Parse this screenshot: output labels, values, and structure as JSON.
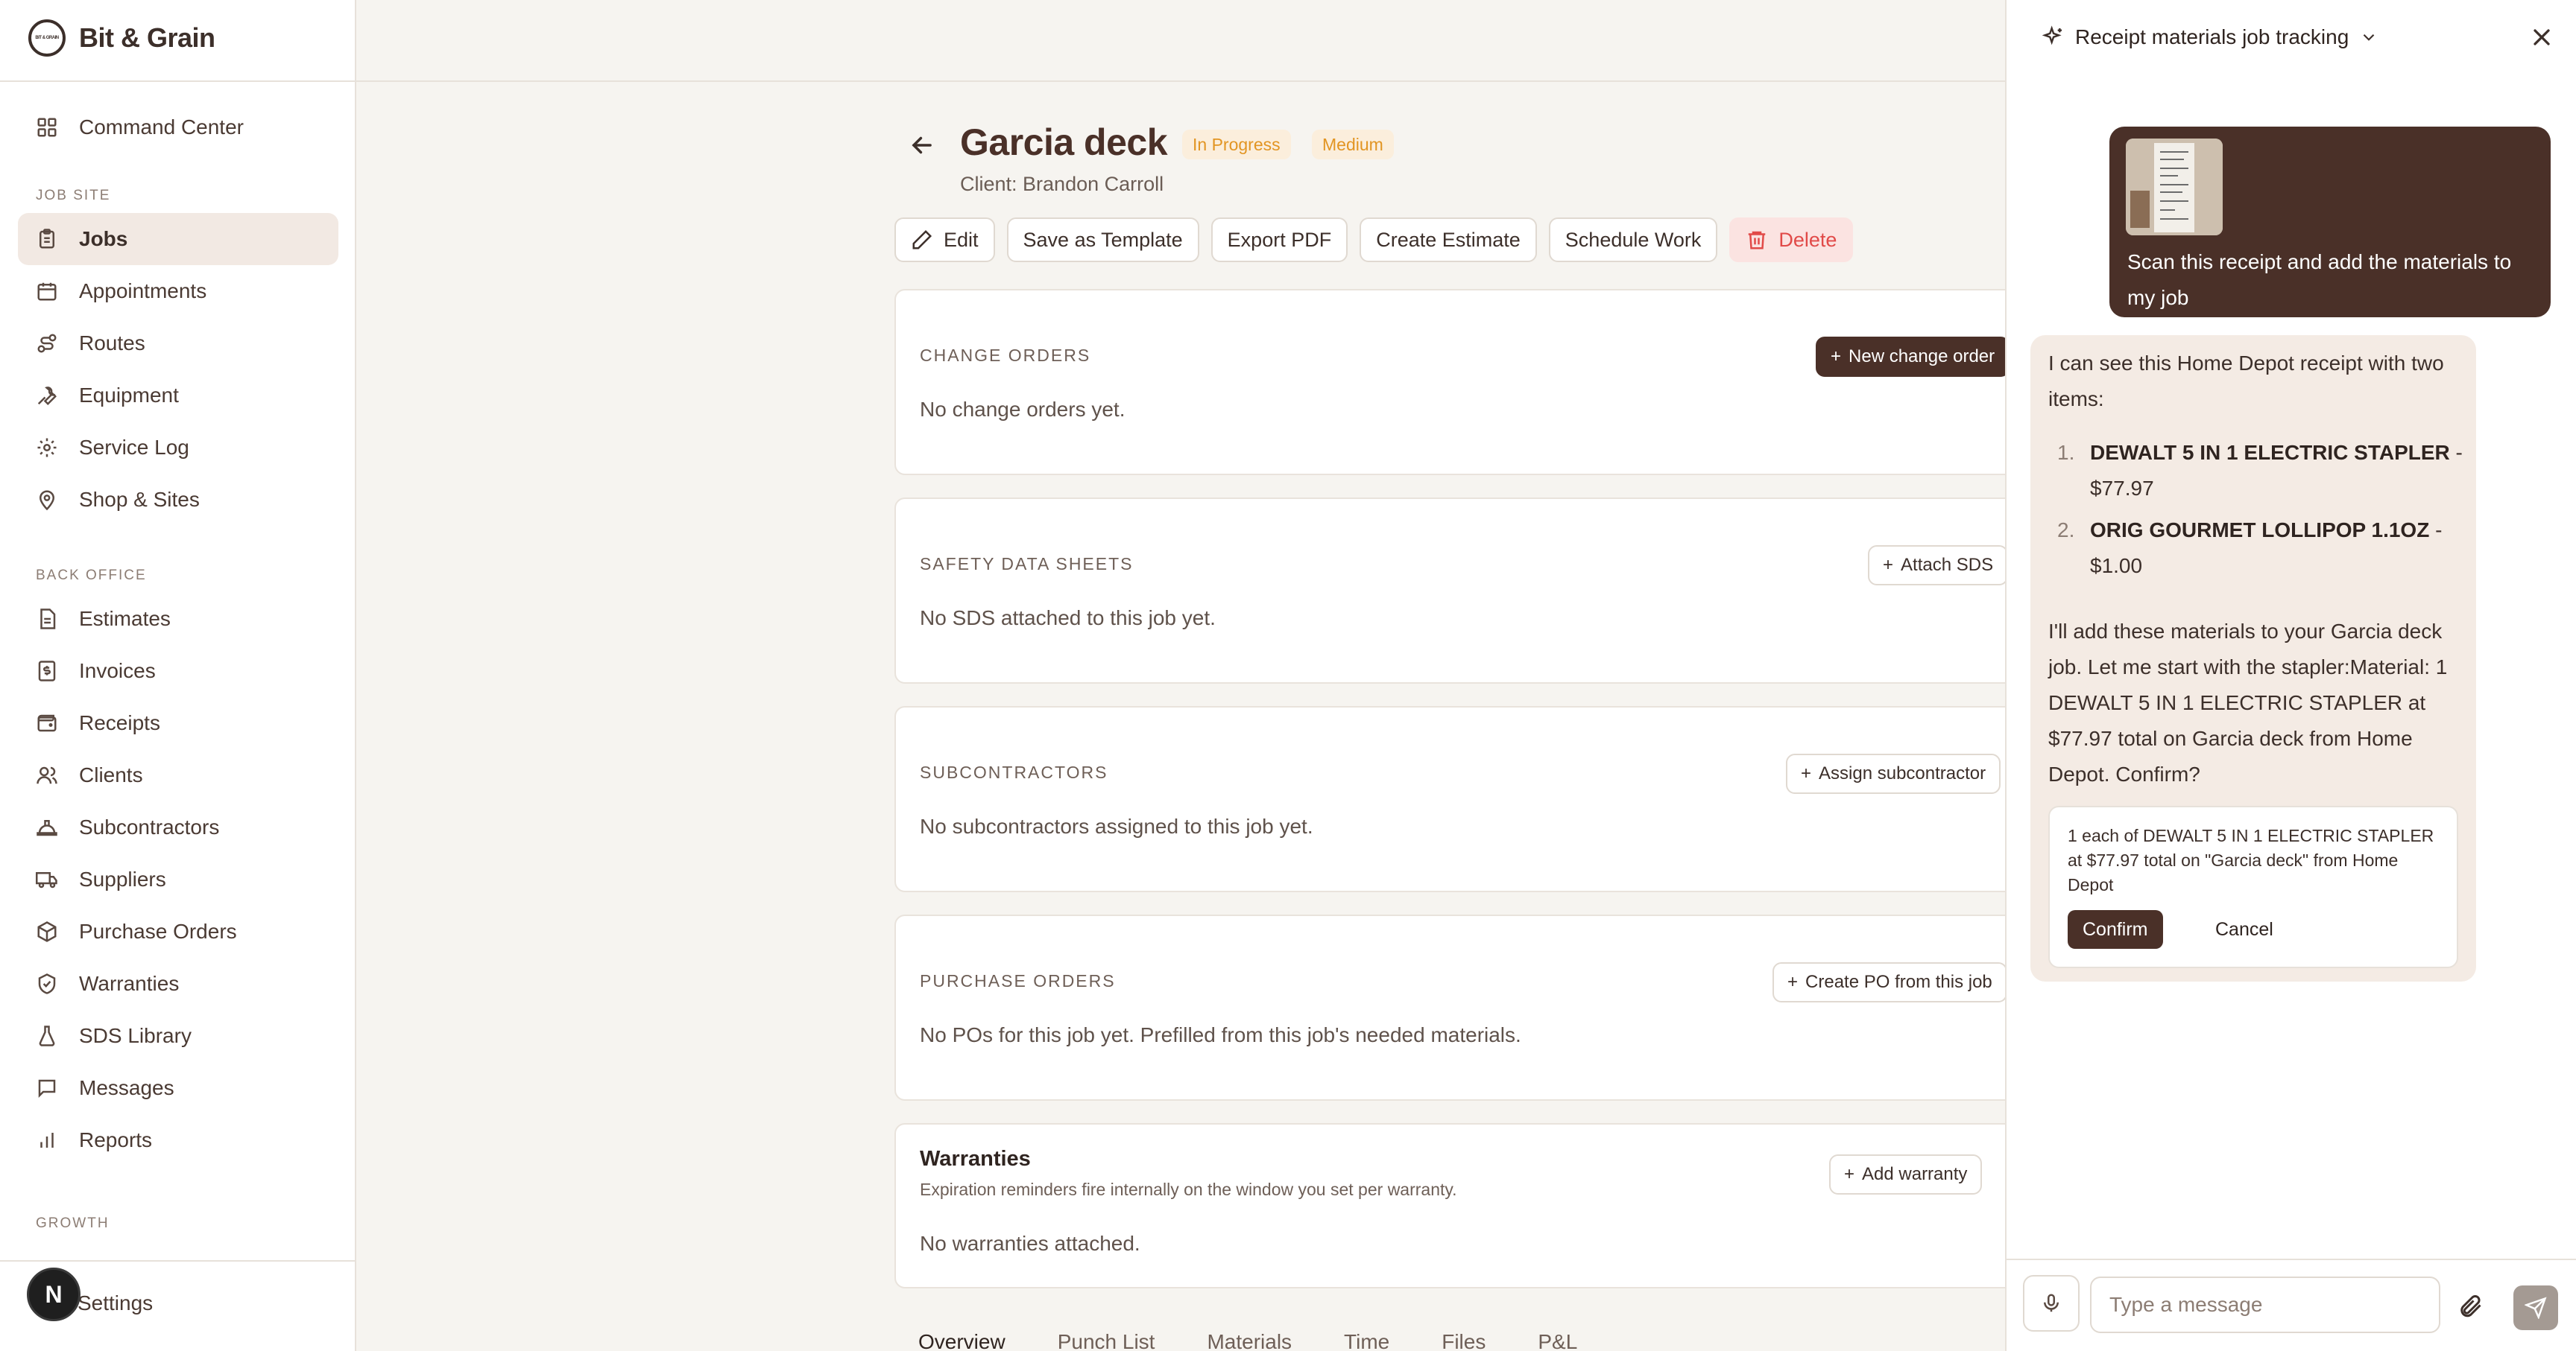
{
  "brand": {
    "name": "Bit & Grain",
    "logo_text": "BIT & GRAIN"
  },
  "sidebar": {
    "top_items": [
      {
        "label": "Command Center",
        "icon": "grid-icon"
      }
    ],
    "job_site_label": "JOB SITE",
    "job_site_items": [
      {
        "label": "Jobs",
        "icon": "clipboard-icon",
        "active": true
      },
      {
        "label": "Appointments",
        "icon": "calendar-icon"
      },
      {
        "label": "Routes",
        "icon": "route-icon"
      },
      {
        "label": "Equipment",
        "icon": "wrench-icon"
      },
      {
        "label": "Service Log",
        "icon": "gear-icon"
      },
      {
        "label": "Shop & Sites",
        "icon": "map-pin-icon"
      }
    ],
    "back_office_label": "BACK OFFICE",
    "back_office_items": [
      {
        "label": "Estimates",
        "icon": "file-icon"
      },
      {
        "label": "Invoices",
        "icon": "dollar-file-icon"
      },
      {
        "label": "Receipts",
        "icon": "wallet-icon"
      },
      {
        "label": "Clients",
        "icon": "users-icon"
      },
      {
        "label": "Subcontractors",
        "icon": "hard-hat-icon"
      },
      {
        "label": "Suppliers",
        "icon": "truck-icon"
      },
      {
        "label": "Purchase Orders",
        "icon": "box-icon"
      },
      {
        "label": "Warranties",
        "icon": "shield-check-icon"
      },
      {
        "label": "SDS Library",
        "icon": "flask-icon"
      },
      {
        "label": "Messages",
        "icon": "message-icon"
      },
      {
        "label": "Reports",
        "icon": "bar-chart-icon"
      }
    ],
    "growth_label": "GROWTH",
    "settings_label": "Settings",
    "avatar_initial": "N"
  },
  "job": {
    "title": "Garcia deck",
    "status": "In Progress",
    "priority": "Medium",
    "client": "Client: Brandon Carroll",
    "actions": {
      "edit": "Edit",
      "save_template": "Save as Template",
      "export_pdf": "Export PDF",
      "create_estimate": "Create Estimate",
      "schedule_work": "Schedule Work",
      "delete": "Delete"
    },
    "change_orders": {
      "label": "CHANGE ORDERS",
      "button": "New change order",
      "empty": "No change orders yet."
    },
    "sds": {
      "label": "SAFETY DATA SHEETS",
      "button": "Attach SDS",
      "empty": "No SDS attached to this job yet."
    },
    "subcontractors": {
      "label": "SUBCONTRACTORS",
      "button": "Assign subcontractor",
      "empty": "No subcontractors assigned to this job yet."
    },
    "purchase_orders": {
      "label": "PURCHASE ORDERS",
      "button": "Create PO from this job",
      "empty": "No POs for this job yet. Prefilled from this job's needed materials."
    },
    "warranties": {
      "title": "Warranties",
      "subtitle": "Expiration reminders fire internally on the window you set per warranty.",
      "button": "Add warranty",
      "empty": "No warranties attached."
    },
    "tabs": [
      "Overview",
      "Punch List",
      "Materials",
      "Time",
      "Files",
      "P&L"
    ]
  },
  "chat": {
    "title": "Receipt materials job tracking",
    "user_message": "Scan this receipt and add the materials to my job",
    "ai_intro": "I can see this Home Depot receipt with two items:",
    "items": [
      {
        "num": "1.",
        "name": "DEWALT 5 IN 1 ELECTRIC STAPLER",
        "price": " - $77.97"
      },
      {
        "num": "2.",
        "name": "ORIG GOURMET LOLLIPOP 1.1OZ",
        "price": " - $1.00"
      }
    ],
    "ai_followup": "I'll add these materials to your Garcia deck job. Let me start with the stapler:Material: 1 DEWALT 5 IN 1 ELECTRIC STAPLER at $77.97 total on Garcia deck from Home Depot. Confirm?",
    "confirm_text": "1 each of DEWALT 5 IN 1 ELECTRIC STAPLER at $77.97 total on \"Garcia deck\" from Home Depot",
    "confirm_label": "Confirm",
    "cancel_label": "Cancel",
    "input_placeholder": "Type a message"
  },
  "colors": {
    "accent": "#4a3028",
    "background": "#f6f4f0",
    "badge_text": "#e29523",
    "danger": "#e14a48"
  }
}
